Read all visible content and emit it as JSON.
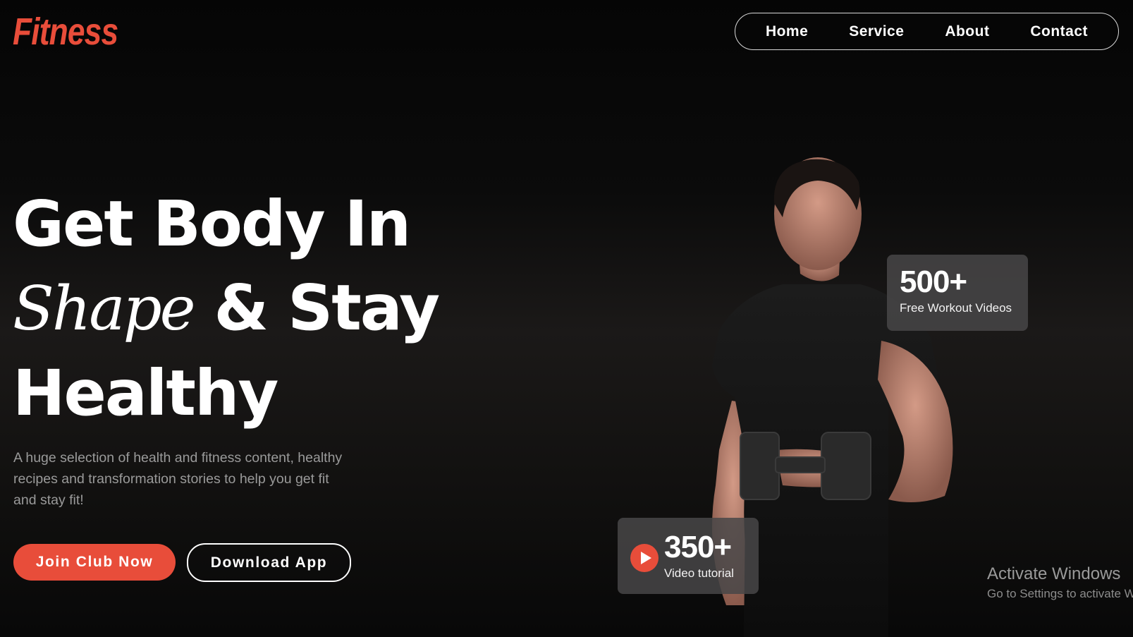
{
  "brand": {
    "logo_text": "Fitness",
    "accent_color": "#e84d3a"
  },
  "nav": {
    "items": [
      "Home",
      "Service",
      "About",
      "Contact"
    ]
  },
  "hero": {
    "headline_line1": "Get Body In",
    "headline_script": "Shape",
    "headline_line2_rest": " & Stay",
    "headline_line3": "Healthy",
    "description": "A huge selection of health and fitness content, healthy recipes and transformation stories to help you get fit and stay fit!",
    "primary_button": "Join Club Now",
    "secondary_button": "Download App"
  },
  "stats": {
    "videos": {
      "number": "500+",
      "label": "Free Workout Videos"
    },
    "tutorial": {
      "number": "350+",
      "label": "Video tutorial",
      "icon": "play-icon"
    }
  },
  "watermark": {
    "title": "Activate Windows",
    "subtitle": "Go to Settings to activate W"
  }
}
